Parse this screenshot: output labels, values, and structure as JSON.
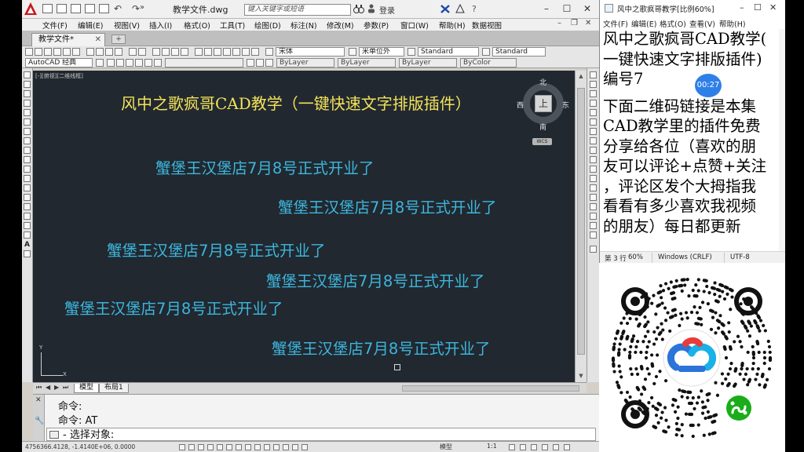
{
  "cad": {
    "title_doc": "教学文件.dwg",
    "search_placeholder": "键入关键字或短语",
    "login": "登录",
    "menu": [
      "文件(F)",
      "编辑(E)",
      "视图(V)",
      "插入(I)",
      "格式(O)",
      "工具(T)",
      "绘图(D)",
      "标注(N)",
      "修改(M)",
      "参数(P)",
      "窗口(W)",
      "帮助(H)",
      "数据视图"
    ],
    "doc_tab": "教学文件*",
    "workspace": "AutoCAD 经典",
    "text_style": "宋体",
    "dim_style": "米单位外",
    "table_style": "Standard",
    "multileader_style": "Standard",
    "layer": "ByLayer",
    "linetype": "ByLayer",
    "lineweight": "ByLayer",
    "plotstyle": "ByColor",
    "viewport_label": "[-][俯视][二维线框]",
    "title_text": "风中之歌疯哥CAD教学（一键快速文字排版插件）",
    "text_lines": [
      "蟹堡王汉堡店7月8号正式开业了",
      "蟹堡王汉堡店7月8号正式开业了",
      "蟹堡王汉堡店7月8号正式开业了",
      "蟹堡王汉堡店7月8号正式开业了",
      "蟹堡王汉堡店7月8号正式开业了",
      "蟹堡王汉堡店7月8号正式开业了"
    ],
    "viewcube": {
      "top": "上",
      "north": "北",
      "south": "南",
      "east": "东",
      "west": "西",
      "wcs": "WCS"
    },
    "ucs": {
      "x": "X",
      "y": "Y"
    },
    "layout_tabs": [
      "模型",
      "布局1"
    ],
    "cmd_history": [
      "命令:",
      "命令: AT"
    ],
    "cmd_prompt": "- 选择对象:",
    "status_coords": "4756366.4128, -1.4140E+06, 0.0000",
    "status_model": "模型",
    "status_scale": "1:1"
  },
  "notepad": {
    "title": "风中之歌疯哥教学[比例60%]",
    "menu": [
      "文件(F)",
      "编辑(E)",
      "格式(O)",
      "查看(V)",
      "帮助(H)"
    ],
    "lines": [
      "风中之歌疯哥CAD教学(",
      "一键快速文字排版插件)",
      "编号7",
      "",
      "下面二维码链接是本集",
      "CAD教学里的插件免费",
      "分享给各位（喜欢的朋",
      "友可以评论+点赞+关注",
      "，评论区发个大拇指我",
      "看看有多少喜欢我视频",
      "的朋友）每日都更新"
    ],
    "status_pos": "第 3 行",
    "status_zoom": "60%",
    "status_eol": "Windows (CRLF)",
    "status_enc": "UTF-8",
    "timer": "00:27"
  },
  "colors": {
    "canvas_bg": "#212830",
    "title_yellow": "#f3e35a",
    "text_cyan": "#3db6dc",
    "timer_blue": "#2f7fe8",
    "qr_green": "#1aad19"
  }
}
